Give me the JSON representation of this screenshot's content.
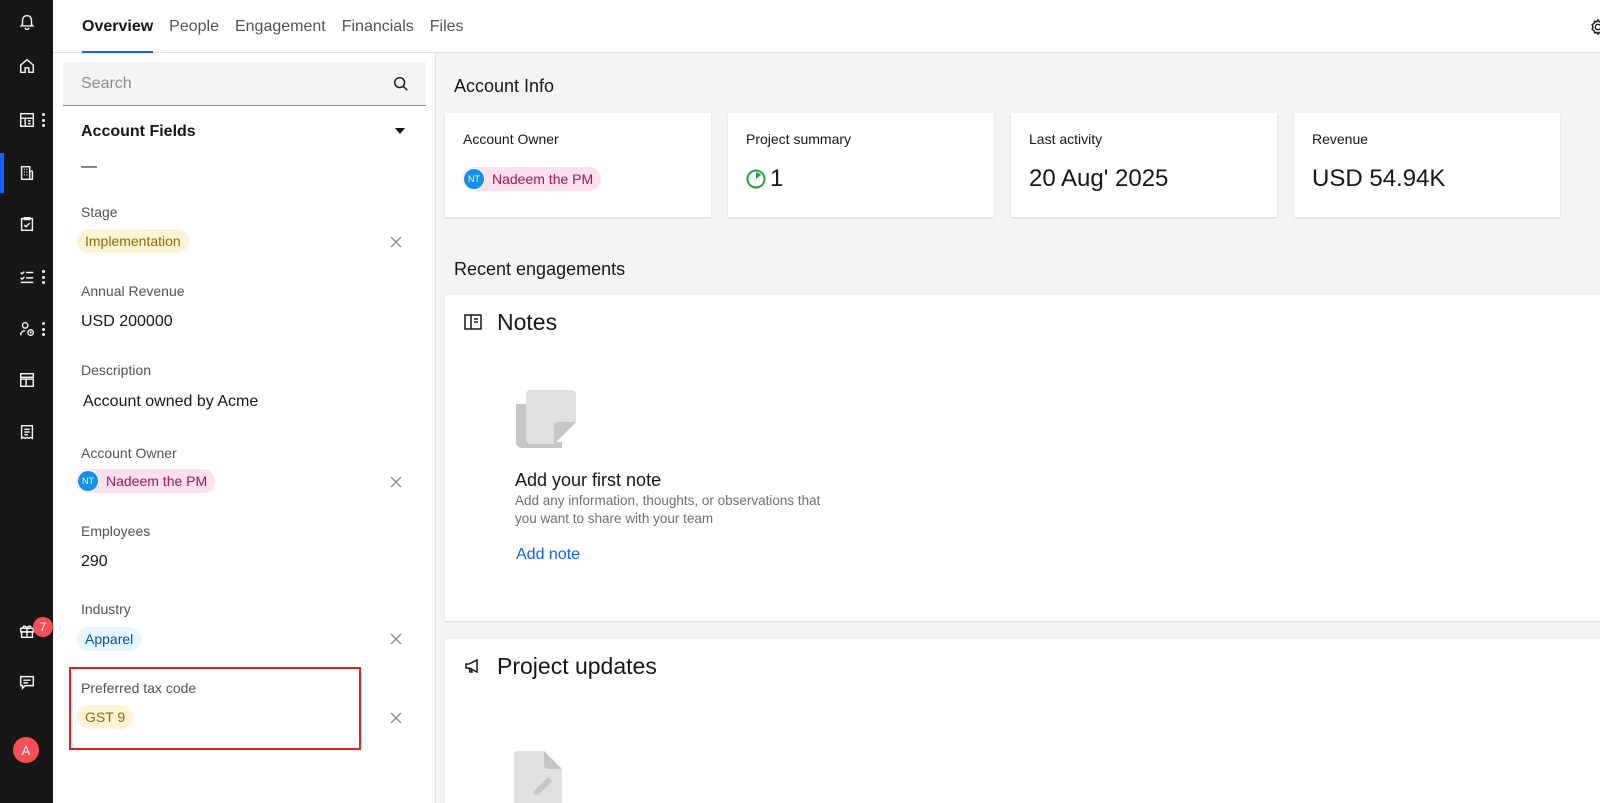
{
  "rail": {
    "items": [
      "notifications",
      "home",
      "reports",
      "accounts",
      "tasks",
      "checklists",
      "people",
      "templates",
      "invoices"
    ],
    "notification_count": "7",
    "avatar_initial": "A"
  },
  "tabs": [
    "Overview",
    "People",
    "Engagement",
    "Financials",
    "Files"
  ],
  "sidebar": {
    "search_placeholder": "Search",
    "section_title": "Account Fields",
    "dash": "—",
    "fields": {
      "stage": {
        "label": "Stage",
        "value": "Implementation"
      },
      "annual_revenue": {
        "label": "Annual Revenue",
        "value": "USD 200000"
      },
      "description": {
        "label": "Description",
        "value": "Account owned by Acme"
      },
      "account_owner": {
        "label": "Account Owner",
        "initials": "NT",
        "value": "Nadeem the PM"
      },
      "employees": {
        "label": "Employees",
        "value": "290"
      },
      "industry": {
        "label": "Industry",
        "value": "Apparel"
      },
      "tax_code": {
        "label": "Preferred tax code",
        "value": "GST 9"
      }
    }
  },
  "main": {
    "account_info_title": "Account Info",
    "cards": {
      "owner": {
        "label": "Account Owner",
        "initials": "NT",
        "value": "Nadeem the PM"
      },
      "summary": {
        "label": "Project summary",
        "value": "1"
      },
      "activity": {
        "label": "Last activity",
        "value": "20 Aug' 2025"
      },
      "revenue": {
        "label": "Revenue",
        "value": "USD 54.94K"
      }
    },
    "recent_title": "Recent engagements",
    "notes": {
      "title": "Notes",
      "empty_title": "Add your first note",
      "empty_desc": "Add any information, thoughts, or observations that you want to share with your team",
      "action": "Add note"
    },
    "updates": {
      "title": "Project updates"
    }
  },
  "colors": {
    "accent": "#0f62fe",
    "rail": "#161616",
    "highlight": "#e0201f"
  }
}
